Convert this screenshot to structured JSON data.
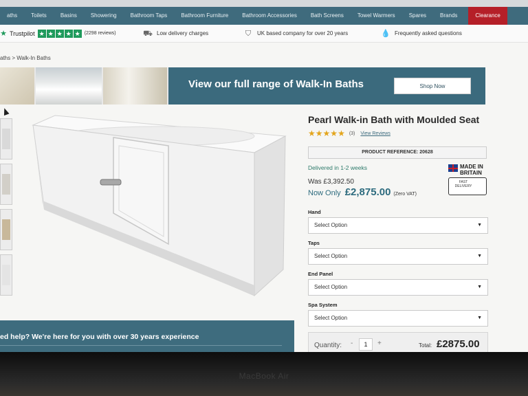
{
  "nav": {
    "items": [
      "aths",
      "Toilets",
      "Basins",
      "Showering",
      "Bathroom Taps",
      "Bathroom Furniture",
      "Bathroom Accessories",
      "Bath Screens",
      "Towel Warmers",
      "Spares",
      "Brands"
    ],
    "clearance": "Clearance"
  },
  "usp": {
    "trustpilot": "Trustpilot",
    "reviews": "(2298 reviews)",
    "delivery": "Low delivery charges",
    "company": "UK based company for over 20 years",
    "faq": "Frequently asked questions"
  },
  "breadcrumb": "aths > Walk-In Baths",
  "banner": {
    "text": "View our full range of Walk-In Baths",
    "button": "Shop Now"
  },
  "help": {
    "text": "ed help? We're here for you with over 30 years experience"
  },
  "product": {
    "title": "Pearl Walk-in Bath with Moulded Seat",
    "rating": 5,
    "review_count": "(3)",
    "view_reviews": "View Reviews",
    "reference": "PRODUCT REFERENCE: 20628",
    "delivered": "Delivered in 1-2 weeks",
    "was": "Was £3,392.50",
    "now_label": "Now Only",
    "now_price": "£2,875.00",
    "vat": "(Zero VAT)",
    "made_in_britain": "MADE IN BRITAIN",
    "fast_delivery": "FAST DELIVERY"
  },
  "options": [
    {
      "label": "Hand",
      "value": "Select Option"
    },
    {
      "label": "Taps",
      "value": "Select Option"
    },
    {
      "label": "End Panel",
      "value": "Select Option"
    },
    {
      "label": "Spa System",
      "value": "Select Option"
    }
  ],
  "quantity": {
    "label": "Quantity:",
    "minus": "-",
    "value": "1",
    "plus": "+",
    "total_label": "Total:",
    "total_value": "£2875.00"
  },
  "bezel": "MacBook Air",
  "colors": {
    "nav": "#3f6b7d",
    "clearance": "#b51f28",
    "trustpilot": "#1f9a5c",
    "star": "#e3a51c",
    "accent": "#2d6b7e"
  }
}
